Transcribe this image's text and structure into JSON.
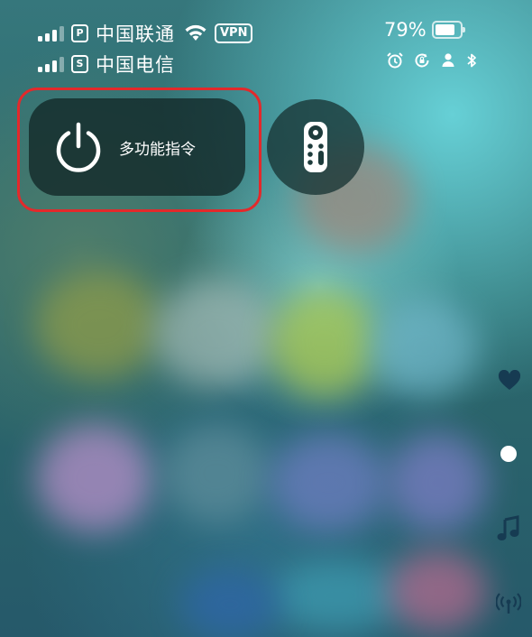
{
  "status_bar": {
    "sim1": {
      "badge": "P",
      "carrier": "中国联通",
      "vpn": "VPN"
    },
    "sim2": {
      "badge": "S",
      "carrier": "中国电信"
    },
    "battery_percent": "79%",
    "battery_level": 0.79,
    "icons": [
      "alarm-icon",
      "rotation-lock-icon",
      "person-icon",
      "bluetooth-icon"
    ]
  },
  "control_center": {
    "power_tile": {
      "icon": "power-icon",
      "label": "多功能指令"
    },
    "remote_button": {
      "icon": "apple-tv-remote-icon"
    }
  },
  "side_indicators": [
    "heart-icon",
    "dot-indicator",
    "music-note-icon",
    "antenna-icon"
  ],
  "colors": {
    "highlight": "#e3292b",
    "tile_bg": "#122626"
  }
}
